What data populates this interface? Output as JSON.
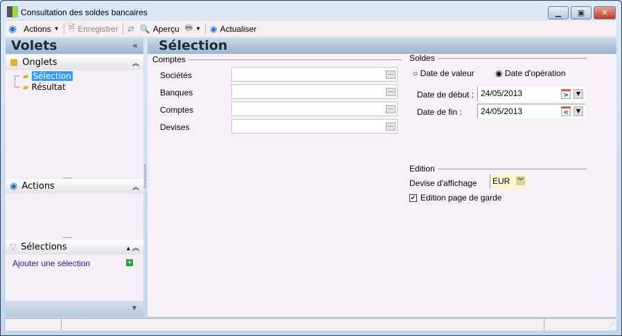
{
  "window": {
    "title": "Consultation des soldes bancaires"
  },
  "toolbar": {
    "actions": "Actions",
    "save": "Enregistrer",
    "preview": "Aperçu",
    "refresh": "Actualiser"
  },
  "left": {
    "title": "Volets",
    "tabs_header": "Onglets",
    "tree": [
      "Sélection",
      "Résultat"
    ],
    "actions_header": "Actions",
    "selections_header": "Sélections",
    "add_selection": "Ajouter une sélection"
  },
  "main": {
    "title": "Sélection",
    "comptes": {
      "legend": "Comptes",
      "fields": [
        {
          "label": "Sociétés",
          "value": ""
        },
        {
          "label": "Banques",
          "value": ""
        },
        {
          "label": "Comptes",
          "value": ""
        },
        {
          "label": "Devises",
          "value": ""
        }
      ]
    },
    "soldes": {
      "legend": "Soldes",
      "radio_value": "Date de valeur",
      "radio_operation": "Date d'opération",
      "selected": "Date d'opération",
      "start_label": "Date de début :",
      "start_value": "24/05/2013",
      "end_label": "Date de fin :",
      "end_value": "24/05/2013"
    },
    "edition": {
      "legend": "Edition",
      "currency_label": "Devise d'affichage",
      "currency_value": "EUR",
      "cover_label": "Edition page de garde",
      "cover_checked": true
    }
  }
}
